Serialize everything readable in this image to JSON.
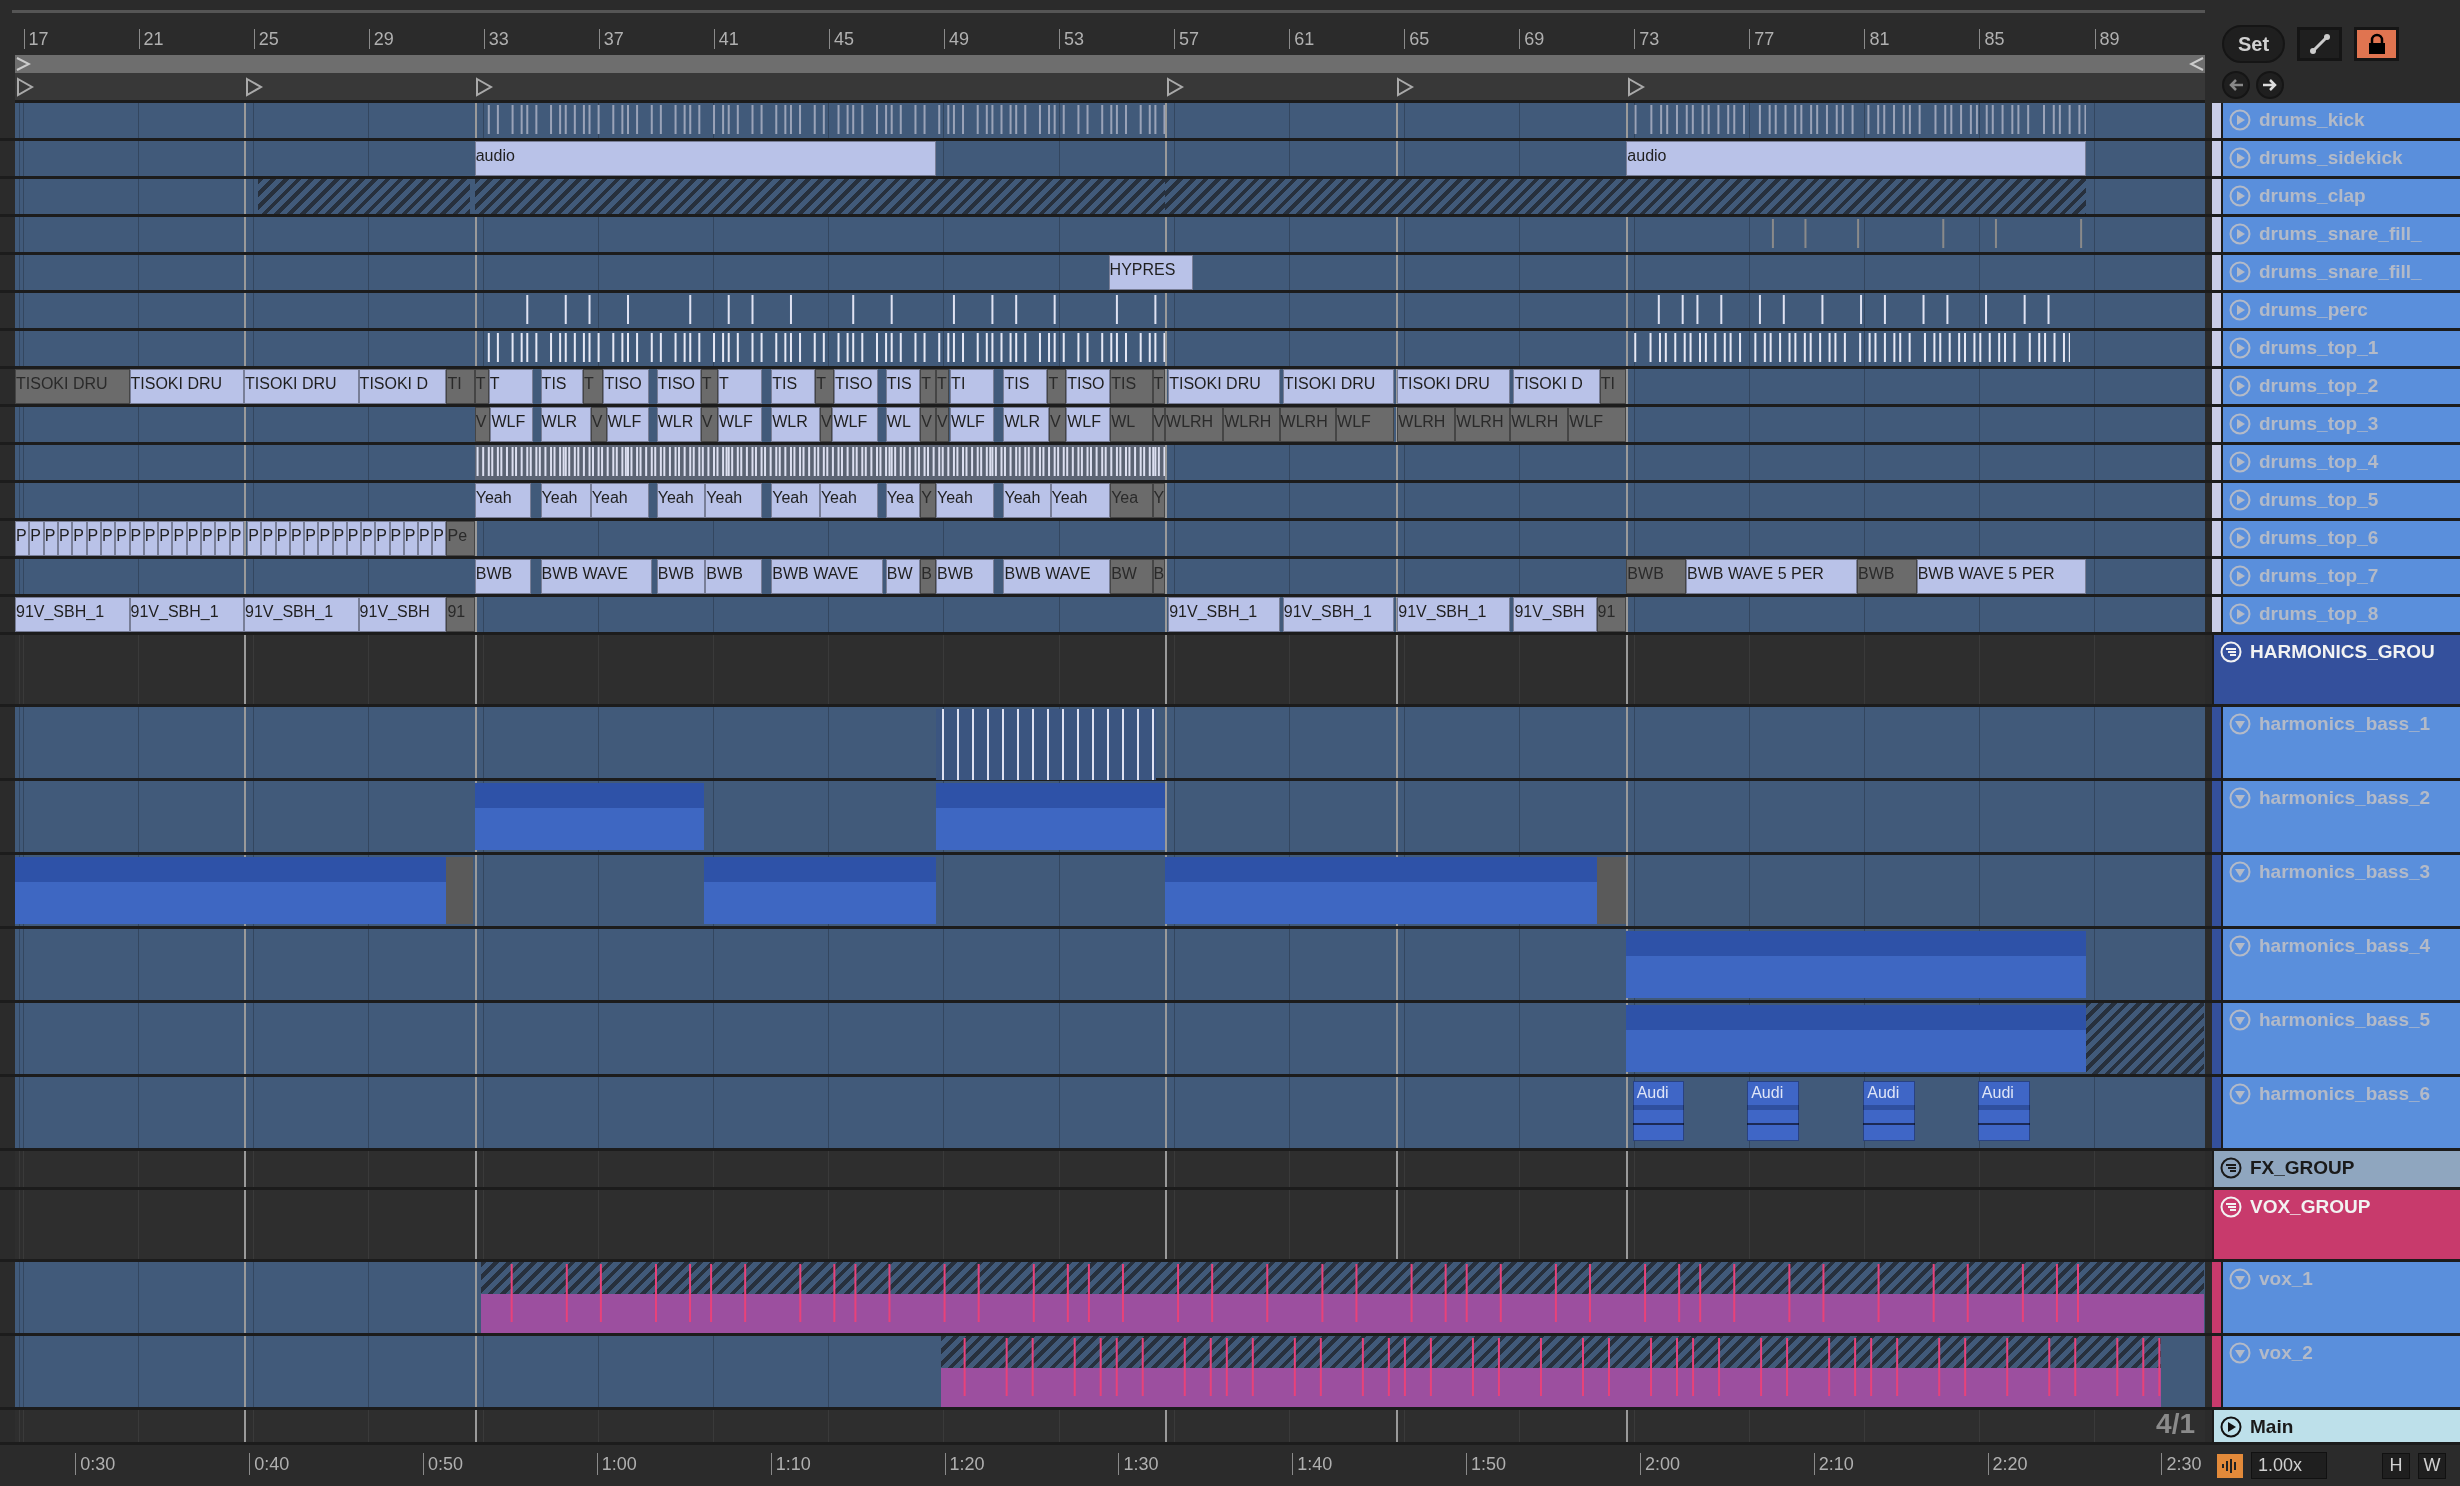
{
  "toolbar": {
    "set_button": "Set",
    "locked": true
  },
  "bar_ruler": [
    "17",
    "21",
    "25",
    "29",
    "33",
    "37",
    "41",
    "45",
    "49",
    "53",
    "57",
    "61",
    "65",
    "69",
    "73",
    "77",
    "81",
    "85",
    "89"
  ],
  "tracks": [
    {
      "name": "drums_kick",
      "kind": "track",
      "expanded": false,
      "color": "#5a8fdc"
    },
    {
      "name": "drums_sidekick",
      "kind": "track",
      "expanded": false,
      "color": "#5a8fdc",
      "clips": [
        {
          "label": "audio",
          "active": true
        },
        {
          "label": "audio",
          "active": true
        }
      ]
    },
    {
      "name": "drums_clap",
      "kind": "track",
      "expanded": false,
      "color": "#5a8fdc"
    },
    {
      "name": "drums_snare_fill_",
      "kind": "track",
      "expanded": false,
      "color": "#5a8fdc"
    },
    {
      "name": "drums_snare_fill_",
      "kind": "track",
      "expanded": false,
      "color": "#5a8fdc",
      "clips": [
        {
          "label": "HYPRES",
          "active": true
        }
      ]
    },
    {
      "name": "drums_perc",
      "kind": "track",
      "expanded": false,
      "color": "#5a8fdc"
    },
    {
      "name": "drums_top_1",
      "kind": "track",
      "expanded": false,
      "color": "#5a8fdc"
    },
    {
      "name": "drums_top_2",
      "kind": "track",
      "expanded": false,
      "color": "#5a8fdc",
      "clips": [
        {
          "label": "TISOKI DRU",
          "active": false
        },
        {
          "label": "TISOKI DRU",
          "active": true
        },
        {
          "label": "TISOKI DRU",
          "active": true
        },
        {
          "label": "TISOKI D",
          "active": true
        },
        {
          "label": "TI",
          "active": false
        },
        {
          "label": "T",
          "active": false
        },
        {
          "label": "T",
          "active": true
        },
        {
          "label": "TIS",
          "active": true
        },
        {
          "label": "T",
          "active": false
        },
        {
          "label": "TISO",
          "active": true
        },
        {
          "label": "TISO",
          "active": true
        },
        {
          "label": "T",
          "active": false
        },
        {
          "label": "T",
          "active": true
        },
        {
          "label": "TIS",
          "active": true
        },
        {
          "label": "T",
          "active": false
        },
        {
          "label": "TISO",
          "active": true
        },
        {
          "label": "TIS",
          "active": true
        },
        {
          "label": "T",
          "active": false
        },
        {
          "label": "T",
          "active": false
        },
        {
          "label": "TI",
          "active": true
        },
        {
          "label": "TIS",
          "active": true
        },
        {
          "label": "T",
          "active": false
        },
        {
          "label": "TISO",
          "active": true
        },
        {
          "label": "TIS",
          "active": false
        },
        {
          "label": "T",
          "active": false
        },
        {
          "label": "TISOKI DRU",
          "active": true
        },
        {
          "label": "TISOKI DRU",
          "active": true
        },
        {
          "label": "TISOKI DRU",
          "active": true
        },
        {
          "label": "TISOKI D",
          "active": true
        },
        {
          "label": "TI",
          "active": false
        }
      ]
    },
    {
      "name": "drums_top_3",
      "kind": "track",
      "expanded": false,
      "color": "#5a8fdc",
      "clips": [
        {
          "label": "V",
          "active": false
        },
        {
          "label": "WLF",
          "active": true
        },
        {
          "label": "WLR",
          "active": true
        },
        {
          "label": "V",
          "active": false
        },
        {
          "label": "WLF",
          "active": true
        },
        {
          "label": "WLR",
          "active": true
        },
        {
          "label": "V",
          "active": false
        },
        {
          "label": "WLF",
          "active": true
        },
        {
          "label": "WLR",
          "active": true
        },
        {
          "label": "V",
          "active": false
        },
        {
          "label": "WLF",
          "active": true
        },
        {
          "label": "WL",
          "active": true
        },
        {
          "label": "V",
          "active": false
        },
        {
          "label": "V",
          "active": false
        },
        {
          "label": "WLF",
          "active": true
        },
        {
          "label": "WLR",
          "active": true
        },
        {
          "label": "V",
          "active": false
        },
        {
          "label": "WLF",
          "active": true
        },
        {
          "label": "WL",
          "active": false
        },
        {
          "label": "V",
          "active": false
        },
        {
          "label": "WLRH",
          "active": false
        },
        {
          "label": "WLRH",
          "active": false
        },
        {
          "label": "WLRH",
          "active": false
        },
        {
          "label": "WLF",
          "active": false
        },
        {
          "label": "WLRH",
          "active": false
        },
        {
          "label": "WLRH",
          "active": false
        },
        {
          "label": "WLRH",
          "active": false
        },
        {
          "label": "WLF",
          "active": false
        }
      ]
    },
    {
      "name": "drums_top_4",
      "kind": "track",
      "expanded": false,
      "color": "#5a8fdc"
    },
    {
      "name": "drums_top_5",
      "kind": "track",
      "expanded": false,
      "color": "#5a8fdc",
      "clips": [
        {
          "label": "Yeah",
          "active": true
        },
        {
          "label": "Yeah",
          "active": true
        },
        {
          "label": "Yeah",
          "active": true
        },
        {
          "label": "Yeah",
          "active": true
        },
        {
          "label": "Yeah",
          "active": true
        },
        {
          "label": "Yeah",
          "active": true
        },
        {
          "label": "Yeah",
          "active": true
        },
        {
          "label": "Yea",
          "active": true
        },
        {
          "label": "Y",
          "active": false
        },
        {
          "label": "Yeah",
          "active": true
        },
        {
          "label": "Yeah",
          "active": true
        },
        {
          "label": "Yeah",
          "active": true
        },
        {
          "label": "Yea",
          "active": false
        },
        {
          "label": "Y",
          "active": false
        }
      ]
    },
    {
      "name": "drums_top_6",
      "kind": "track",
      "expanded": false,
      "color": "#5a8fdc",
      "clips": [
        {
          "label": "P",
          "active": true
        },
        {
          "label": "P",
          "active": true
        },
        {
          "label": "P",
          "active": true
        },
        {
          "label": "P",
          "active": true
        },
        {
          "label": "P",
          "active": true
        },
        {
          "label": "P",
          "active": true
        },
        {
          "label": "P",
          "active": true
        },
        {
          "label": "P",
          "active": true
        },
        {
          "label": "P",
          "active": true
        },
        {
          "label": "P",
          "active": true
        },
        {
          "label": "P",
          "active": true
        },
        {
          "label": "P",
          "active": true
        },
        {
          "label": "P",
          "active": true
        },
        {
          "label": "P",
          "active": true
        },
        {
          "label": "P",
          "active": true
        },
        {
          "label": "P",
          "active": true
        },
        {
          "label": "P",
          "active": true
        },
        {
          "label": "P",
          "active": true
        },
        {
          "label": "P",
          "active": true
        },
        {
          "label": "P",
          "active": true
        },
        {
          "label": "P",
          "active": true
        },
        {
          "label": "P",
          "active": true
        },
        {
          "label": "P",
          "active": true
        },
        {
          "label": "P",
          "active": true
        },
        {
          "label": "P",
          "active": true
        },
        {
          "label": "P",
          "active": true
        },
        {
          "label": "P",
          "active": true
        },
        {
          "label": "P",
          "active": true
        },
        {
          "label": "P",
          "active": true
        },
        {
          "label": "P",
          "active": true
        },
        {
          "label": "Pe",
          "active": false
        }
      ]
    },
    {
      "name": "drums_top_7",
      "kind": "track",
      "expanded": false,
      "color": "#5a8fdc",
      "clips": [
        {
          "label": "BWB",
          "active": true
        },
        {
          "label": "BWB WAVE",
          "active": true
        },
        {
          "label": "BWB",
          "active": true
        },
        {
          "label": "BWB",
          "active": true
        },
        {
          "label": "BWB WAVE",
          "active": true
        },
        {
          "label": "BW",
          "active": true
        },
        {
          "label": "B",
          "active": false
        },
        {
          "label": "BWB",
          "active": true
        },
        {
          "label": "BWB WAVE",
          "active": true
        },
        {
          "label": "BW",
          "active": false
        },
        {
          "label": "B",
          "active": false
        },
        {
          "label": "BWB",
          "active": false
        },
        {
          "label": "BWB WAVE 5 PER",
          "active": true
        },
        {
          "label": "BWB",
          "active": false
        },
        {
          "label": "BWB WAVE 5 PER",
          "active": true
        }
      ]
    },
    {
      "name": "drums_top_8",
      "kind": "track",
      "expanded": false,
      "color": "#5a8fdc",
      "clips": [
        {
          "label": "91V_SBH_1",
          "active": true
        },
        {
          "label": "91V_SBH_1",
          "active": true
        },
        {
          "label": "91V_SBH_1",
          "active": true
        },
        {
          "label": "91V_SBH",
          "active": true
        },
        {
          "label": "91",
          "active": false
        },
        {
          "label": "91V_SBH_1",
          "active": true
        },
        {
          "label": "91V_SBH_1",
          "active": true
        },
        {
          "label": "91V_SBH_1",
          "active": true
        },
        {
          "label": "91V_SBH",
          "active": true
        },
        {
          "label": "91",
          "active": false
        }
      ]
    },
    {
      "name": "HARMONICS_GROU",
      "kind": "group",
      "expanded": true,
      "color": "#34509c",
      "children": [
        {
          "name": "harmonics_bass_1",
          "kind": "track",
          "expanded": true,
          "color": "#5a8fdc"
        },
        {
          "name": "harmonics_bass_2",
          "kind": "track",
          "expanded": true,
          "color": "#5a8fdc"
        },
        {
          "name": "harmonics_bass_3",
          "kind": "track",
          "expanded": true,
          "color": "#5a8fdc"
        },
        {
          "name": "harmonics_bass_4",
          "kind": "track",
          "expanded": true,
          "color": "#5a8fdc"
        },
        {
          "name": "harmonics_bass_5",
          "kind": "track",
          "expanded": true,
          "color": "#5a8fdc"
        },
        {
          "name": "harmonics_bass_6",
          "kind": "track",
          "expanded": true,
          "color": "#5a8fdc",
          "clips": [
            {
              "label": "Audi",
              "active": true
            },
            {
              "label": "Audi",
              "active": true
            },
            {
              "label": "Audi",
              "active": true
            },
            {
              "label": "Audi",
              "active": true
            }
          ]
        }
      ]
    },
    {
      "name": "FX_GROUP",
      "kind": "group",
      "expanded": false,
      "color": "#8fa6bf"
    },
    {
      "name": "VOX_GROUP",
      "kind": "group",
      "expanded": true,
      "color": "#c83a6c",
      "children": [
        {
          "name": "vox_1",
          "kind": "track",
          "expanded": true,
          "color": "#5a8fdc"
        },
        {
          "name": "vox_2",
          "kind": "track",
          "expanded": true,
          "color": "#5a8fdc"
        }
      ]
    },
    {
      "name": "Main",
      "kind": "main",
      "color": "#bde0ea"
    }
  ],
  "grid_label": "4/1",
  "time_ruler": [
    "0:30",
    "0:40",
    "0:50",
    "1:00",
    "1:10",
    "1:20",
    "1:30",
    "1:40",
    "1:50",
    "2:00",
    "2:10",
    "2:20",
    "2:30"
  ],
  "footer": {
    "tempo_factor": "1.00x",
    "buttons": [
      "H",
      "W"
    ]
  }
}
